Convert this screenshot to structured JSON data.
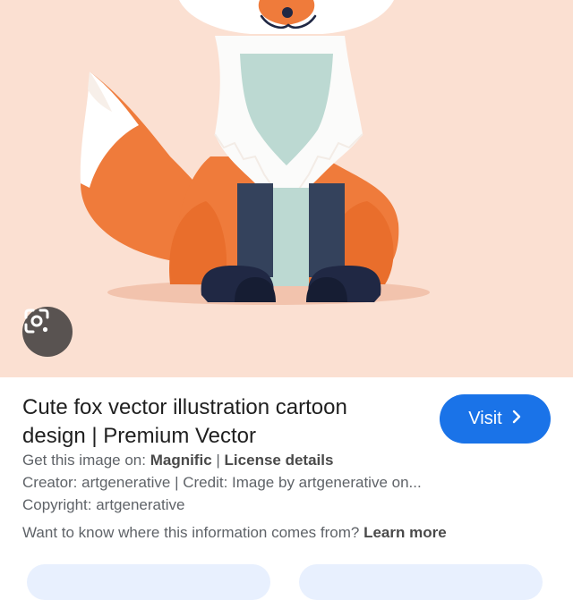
{
  "result": {
    "title": "Cute fox vector illustration cartoon design | Premium Vector",
    "visit_label": "Visit",
    "get_image_prefix": "Get this image on:",
    "source_name": "Magnific",
    "separator": "|",
    "license_label": "License details",
    "creator_text": "Creator: artgenerative | Credit: Image by artgenerative on...",
    "copyright_text": "Copyright: artgenerative",
    "info_question": "Want to know where this information comes from?",
    "learn_more_label": "Learn more"
  },
  "icons": {
    "lens": "lens-search-icon",
    "visit_chevron": "chevron-right-icon"
  },
  "colors": {
    "image_background": "#fbe0d2",
    "visit_button": "#1a73e8",
    "lens_button": "#595351"
  }
}
